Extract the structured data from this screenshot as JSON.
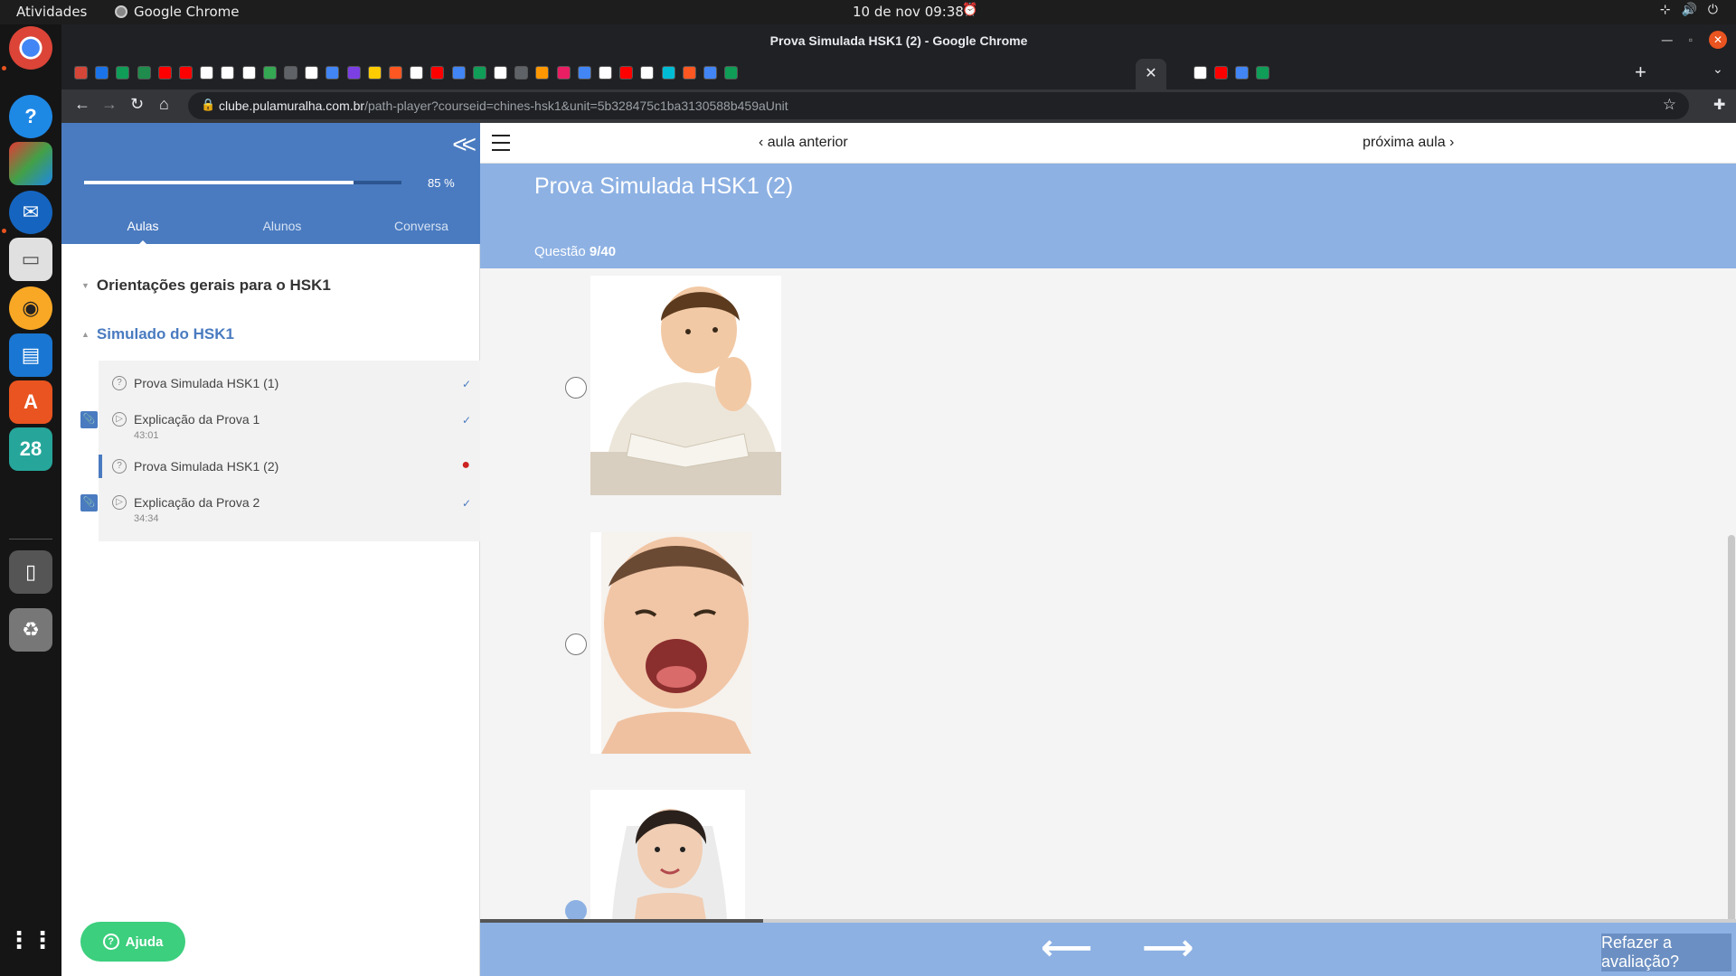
{
  "os": {
    "activities": "Atividades",
    "app_name": "Google Chrome",
    "clock": "10 de nov  09:38"
  },
  "chrome": {
    "window_title": "Prova Simulada HSK1 (2) - Google Chrome",
    "url_domain": "clube.pulamuralha.com.br",
    "url_path": "/path-player?courseid=chines-hsk1&unit=5b328475c1ba3130588b459aUnit",
    "tab_favicon_colors": [
      "#d44638",
      "#1a73e8",
      "#0f9d58",
      "#1f8b4c",
      "#ff0000",
      "#ff0000",
      "#ffffff",
      "#ffffff",
      "#ffffff",
      "#34a853",
      "#5f6368",
      "#ffffff",
      "#4285f4",
      "#7b3fe4",
      "#ffcc00",
      "#ff5722",
      "#ffffff",
      "#ff0000",
      "#4285f4",
      "#0f9d58",
      "#ffffff",
      "#5f6368",
      "#ff9800",
      "#e91e63",
      "#4285f4",
      "#ffffff",
      "#ff0000",
      "#ffffff",
      "#00bcd4",
      "#ff5722",
      "#4285f4",
      "#0f9d58",
      "#ffffff",
      "#ff0000",
      "#4285f4",
      "#0f9d58"
    ]
  },
  "sidebar": {
    "progress_percent": 85,
    "progress_label": "85 %",
    "tabs": [
      {
        "label": "Aulas",
        "active": true
      },
      {
        "label": "Alunos",
        "active": false
      },
      {
        "label": "Conversa",
        "active": false
      }
    ],
    "sections": [
      {
        "title": "Orientações gerais para o HSK1",
        "open": false
      },
      {
        "title": "Simulado do HSK1",
        "open": true
      }
    ],
    "lessons": [
      {
        "title": "Prova Simulada HSK1 (1)",
        "time": "",
        "type": "quiz",
        "status": "done"
      },
      {
        "title": "Explicação da Prova 1",
        "time": "43:01",
        "type": "video",
        "status": "done"
      },
      {
        "title": "Prova Simulada HSK1 (2)",
        "time": "",
        "type": "quiz",
        "status": "pending"
      },
      {
        "title": "Explicação da Prova 2",
        "time": "34:34",
        "type": "video",
        "status": "done"
      }
    ],
    "status_icons": {
      "done": "✓",
      "pending": "●"
    },
    "help_label": "Ajuda"
  },
  "main": {
    "prev_label": "aula anterior",
    "next_label": "próxima aula",
    "quiz_title": "Prova Simulada HSK1 (2)",
    "question_prefix": "Questão",
    "question_number": "9/40",
    "options": [
      {
        "image": "boy-reading-photo",
        "selected": false
      },
      {
        "image": "laughing-baby-photo",
        "selected": false
      },
      {
        "image": "bride-photo",
        "selected": true
      }
    ],
    "bottom_progress_fraction": 0.225,
    "redo_label": "Refazer a avaliação?"
  }
}
